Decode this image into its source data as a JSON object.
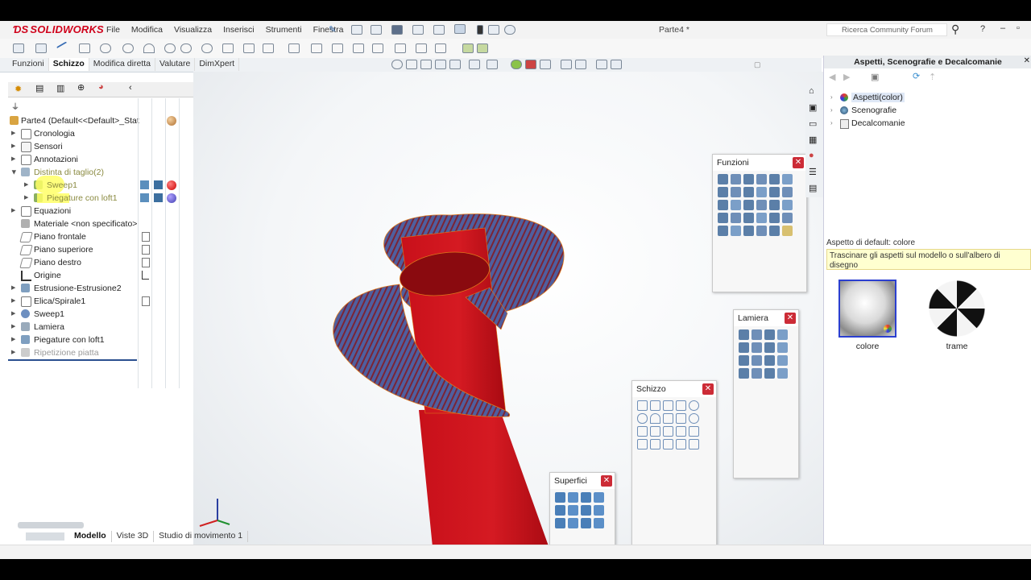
{
  "app": {
    "brand": "SOLIDWORKS",
    "document_title": "Parte4 *",
    "search_placeholder": "Ricerca Community Forum"
  },
  "menu": [
    "File",
    "Modifica",
    "Visualizza",
    "Inserisci",
    "Strumenti",
    "Finestra",
    "?"
  ],
  "command_tabs": [
    {
      "label": "Funzioni",
      "active": false
    },
    {
      "label": "Schizzo",
      "active": true
    },
    {
      "label": "Modifica diretta",
      "active": false
    },
    {
      "label": "Valutare",
      "active": false
    },
    {
      "label": "DimXpert",
      "active": false
    }
  ],
  "tree": {
    "root": "Parte4  (Default<<Default>_Stat",
    "items": [
      {
        "label": "Cronologia"
      },
      {
        "label": "Sensori"
      },
      {
        "label": "Annotazioni"
      },
      {
        "label": "Distinta di taglio(2)"
      },
      {
        "label": "Sweep1"
      },
      {
        "label": "Piegature con loft1"
      },
      {
        "label": "Equazioni"
      },
      {
        "label": "Materiale <non specificato>"
      },
      {
        "label": "Piano frontale"
      },
      {
        "label": "Piano superiore"
      },
      {
        "label": "Piano destro"
      },
      {
        "label": "Origine"
      },
      {
        "label": "Estrusione-Estrusione2"
      },
      {
        "label": "Elica/Spirale1"
      },
      {
        "label": "Sweep1"
      },
      {
        "label": "Lamiera"
      },
      {
        "label": "Piegature con loft1"
      },
      {
        "label": "Ripetizione piatta"
      }
    ]
  },
  "bottom_tabs": [
    {
      "label": "Modello",
      "active": true
    },
    {
      "label": "Viste 3D",
      "active": false
    },
    {
      "label": "Studio di movimento 1",
      "active": false
    }
  ],
  "task_pane": {
    "title": "Aspetti, Scenografie e Decalcomanie",
    "items": [
      "Aspetti(color)",
      "Scenografie",
      "Decalcomanie"
    ],
    "hint_title": "Aspetto di default: colore",
    "hint_text": "Trascinare gli aspetti sul modello o sull'albero di disegno",
    "thumbnails": [
      "colore",
      "trame"
    ]
  },
  "palettes": {
    "funzioni": "Funzioni",
    "lamiera": "Lamiera",
    "schizzo": "Schizzo",
    "superfici": "Superfici"
  },
  "colors": {
    "brand": "#d0021b",
    "model_red": "#c8101a",
    "model_blue": "#4a5b9c",
    "close_button": "#cc2b36",
    "highlight": "#ffff66"
  }
}
